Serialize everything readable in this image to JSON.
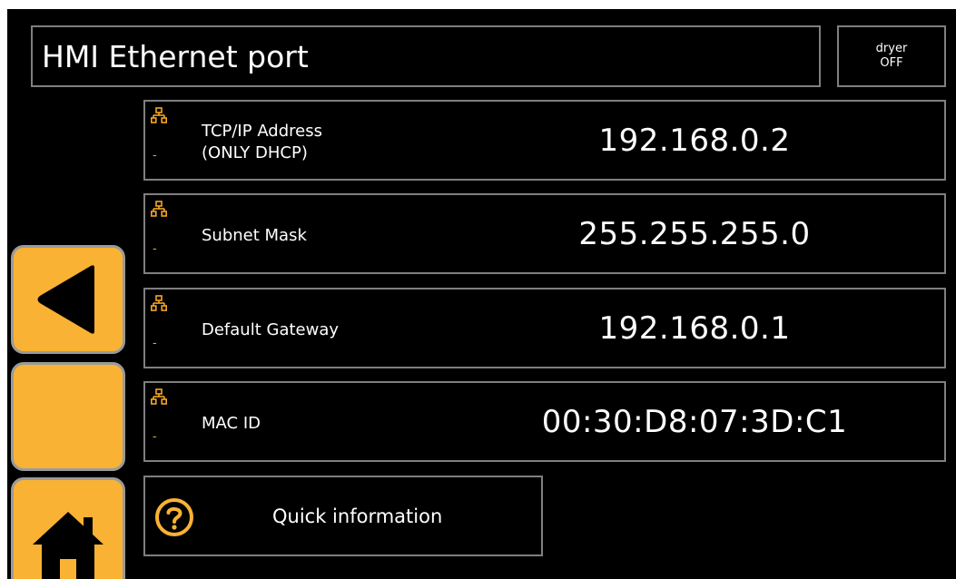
{
  "header": {
    "title": "HMI Ethernet port",
    "status_line1": "dryer",
    "status_line2": "OFF"
  },
  "rows": [
    {
      "label_line1": "TCP/IP Address",
      "label_line2": "(ONLY DHCP)",
      "value": "192.168.0.2",
      "icon": "network-icon",
      "sub": "-"
    },
    {
      "label_line1": "Subnet Mask",
      "label_line2": "",
      "value": "255.255.255.0",
      "icon": "network-icon",
      "sub": "-"
    },
    {
      "label_line1": "Default Gateway",
      "label_line2": "",
      "value": "192.168.0.1",
      "icon": "network-icon",
      "sub": "-"
    },
    {
      "label_line1": "MAC ID",
      "label_line2": "",
      "value": "00:30:D8:07:3D:C1",
      "icon": "network-icon",
      "sub": "-"
    }
  ],
  "quick_info": {
    "label": "Quick information",
    "icon": "question-icon"
  },
  "side_buttons": {
    "back_icon": "back-arrow-icon",
    "blank": "",
    "home_icon": "home-icon"
  },
  "colors": {
    "accent": "#f9b233",
    "icon_orange": "#f5a623",
    "border": "#7f7f7f",
    "background": "#000000"
  }
}
